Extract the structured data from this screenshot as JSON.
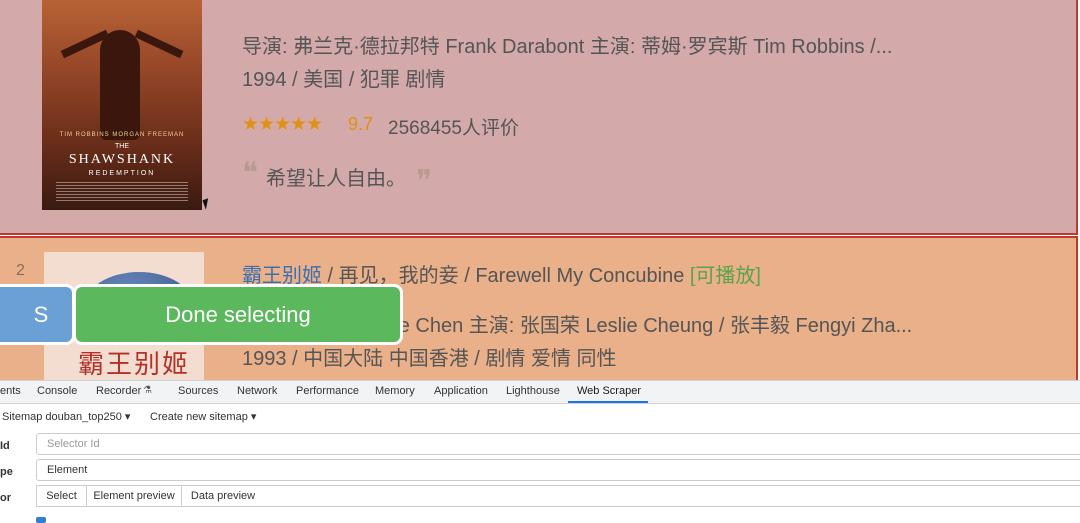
{
  "item1": {
    "poster": {
      "actors_line": "TIM ROBBINS   MORGAN FREEMAN",
      "the": "THE",
      "title": "SHAWSHANK",
      "subtitle": "REDEMPTION"
    },
    "directors_line": "导演: 弗兰克·德拉邦特 Frank Darabont   主演: 蒂姆·罗宾斯 Tim Robbins /...",
    "year_line": "1994 / 美国 / 犯罪 剧情",
    "stars": "★★★★★",
    "rating": "9.7",
    "votes": "2568455人评价",
    "quote_open": "❝",
    "quote": "希望让人自由。",
    "quote_close": "❞"
  },
  "item2": {
    "rank": "2",
    "poster_calligraphy": "霸王别姬",
    "title_main": "霸王别姬",
    "title_rest": " / 再见，我的妾 / Farewell My Concubine ",
    "playable": "[可播放]",
    "directors_line": "导演: 陈凯歌 Kaige Chen   主演: 张国荣 Leslie Cheung / 张丰毅 Fengyi Zha...",
    "year_line": "1993 / 中国大陆 中国香港 / 剧情 爱情 同性"
  },
  "selection_toolbar": {
    "s_label": "S",
    "done_label": "Done selecting"
  },
  "devtools": {
    "tabs": [
      "ents",
      "Console",
      "Recorder",
      "Sources",
      "Network",
      "Performance",
      "Memory",
      "Application",
      "Lighthouse",
      "Web Scraper"
    ],
    "recorder_icon": "flask-icon",
    "web_scraper": {
      "sitemap_menu": "Sitemap douban_top250 ▾",
      "create_menu": "Create new sitemap ▾",
      "id_label": "Id",
      "id_placeholder": "Selector Id",
      "type_label": "pe",
      "type_value": "Element",
      "selector_label": "or",
      "select_button": "Select",
      "element_preview_button": "Element preview",
      "data_preview_button": "Data preview"
    }
  }
}
